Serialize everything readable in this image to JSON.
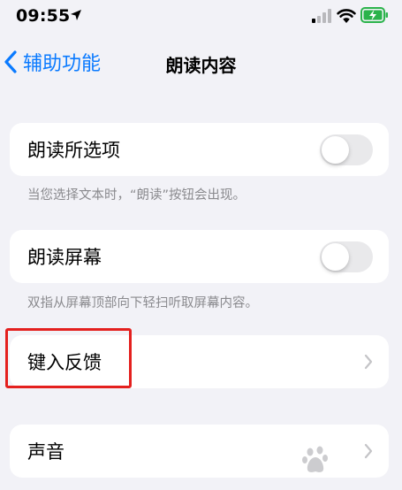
{
  "status_bar": {
    "time": "09:55"
  },
  "nav": {
    "back_label": "辅助功能",
    "title": "朗读内容"
  },
  "sections": [
    {
      "label": "朗读所选项",
      "toggle_on": false,
      "footer": "当您选择文本时，“朗读”按钮会出现。"
    },
    {
      "label": "朗读屏幕",
      "toggle_on": false,
      "footer": "双指从屏幕顶部向下轻扫听取屏幕内容。"
    },
    {
      "label": "键入反馈"
    },
    {
      "label": "声音"
    }
  ],
  "colors": {
    "accent": "#0a7aff",
    "highlight": "#e4201e",
    "background": "#f2f2f7"
  },
  "icons": [
    "location-arrow-icon",
    "signal-icon",
    "wifi-icon",
    "battery-charging-icon",
    "back-chevron-icon",
    "chevron-right-icon"
  ]
}
